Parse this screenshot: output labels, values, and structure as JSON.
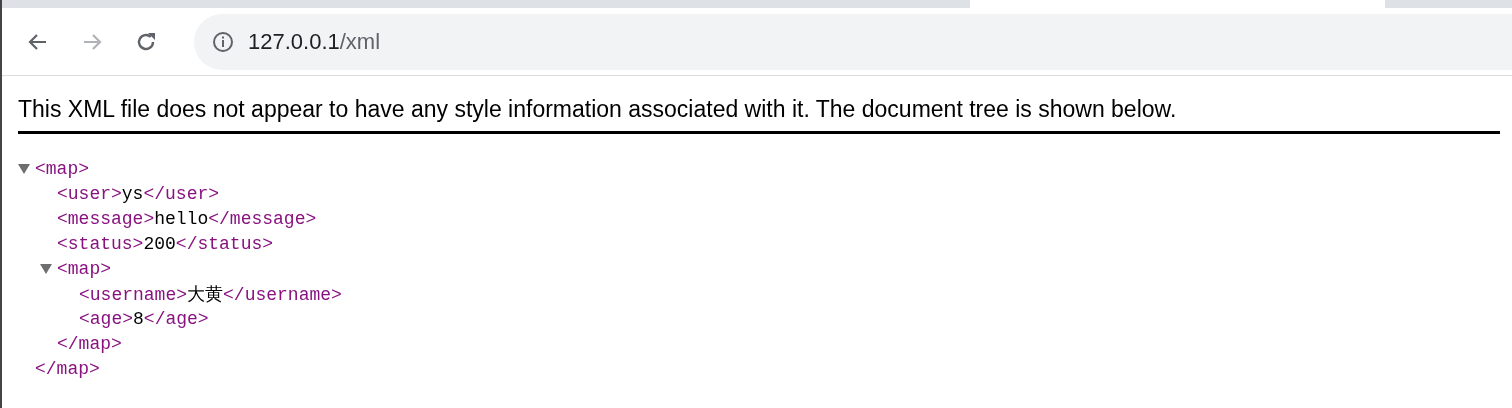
{
  "toolbar": {
    "back": {
      "disabled": false
    },
    "forward": {
      "disabled": true
    },
    "address": {
      "host": "127.0.0.1",
      "path": "/xml"
    }
  },
  "notice": "This XML file does not appear to have any style information associated with it. The document tree is shown below.",
  "tree": {
    "open": "<map>",
    "close": "</map>",
    "expanded": true,
    "children": [
      {
        "open": "<user>",
        "text": "ys",
        "close": "</user>"
      },
      {
        "open": "<message>",
        "text": "hello",
        "close": "</message>"
      },
      {
        "open": "<status>",
        "text": "200",
        "close": "</status>"
      },
      {
        "open": "<map>",
        "close": "</map>",
        "expanded": true,
        "children": [
          {
            "open": "<username>",
            "text": "大黄",
            "close": "</username>"
          },
          {
            "open": "<age>",
            "text": "8",
            "close": "</age>"
          }
        ]
      }
    ]
  }
}
